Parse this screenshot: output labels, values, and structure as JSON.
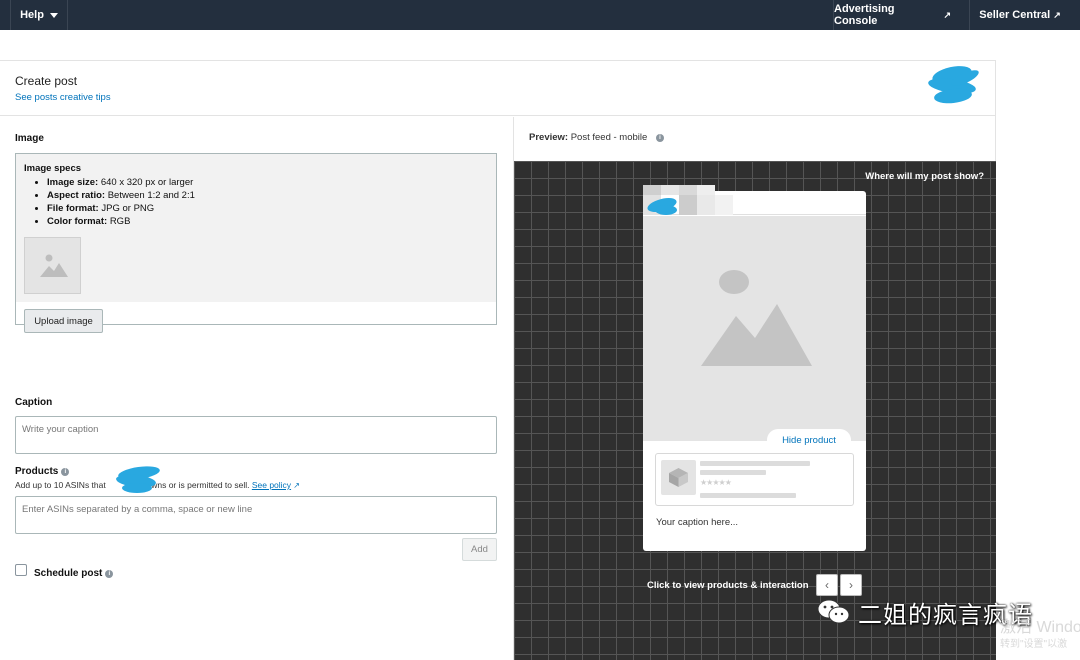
{
  "topbar": {
    "help": "Help",
    "advertising_console": "Advertising Console",
    "seller_central": "Seller Central"
  },
  "header": {
    "title": "Create post",
    "tips_link": "See posts creative tips"
  },
  "image_section": {
    "label": "Image",
    "specs_title": "Image specs",
    "specs": [
      {
        "key": "Image size:",
        "value": "640 x 320 px or larger"
      },
      {
        "key": "Aspect ratio:",
        "value": "Between 1:2 and 2:1"
      },
      {
        "key": "File format:",
        "value": "JPG or PNG"
      },
      {
        "key": "Color format:",
        "value": "RGB"
      }
    ],
    "upload_button": "Upload image"
  },
  "caption_section": {
    "label": "Caption",
    "placeholder": "Write your caption"
  },
  "products_section": {
    "label": "Products",
    "hint_before": "Add up to 10 ASINs that",
    "hint_after": "owns or is permitted to sell.",
    "policy_link": "See policy",
    "placeholder": "Enter ASINs separated by a comma, space or new line",
    "add_button": "Add"
  },
  "schedule": {
    "label": "Schedule post",
    "checked": false
  },
  "preview": {
    "label_bold": "Preview:",
    "label_value": "Post feed - mobile",
    "where_link": "Where will my post show?",
    "hide_product": "Hide product",
    "caption_placeholder": "Your caption here...",
    "click_hint": "Click to view products & interaction",
    "prev_icon": "chevron-left-icon",
    "next_icon": "chevron-right-icon"
  },
  "watermark": {
    "text": "二姐的疯言疯语",
    "activation_line1": "激活 Windo",
    "activation_line2": "转到\"设置\"以激"
  },
  "colors": {
    "topbar_bg": "#232f3e",
    "link": "#0073bb",
    "preview_bg": "#2f2f2f",
    "redaction": "#29a8e0"
  }
}
